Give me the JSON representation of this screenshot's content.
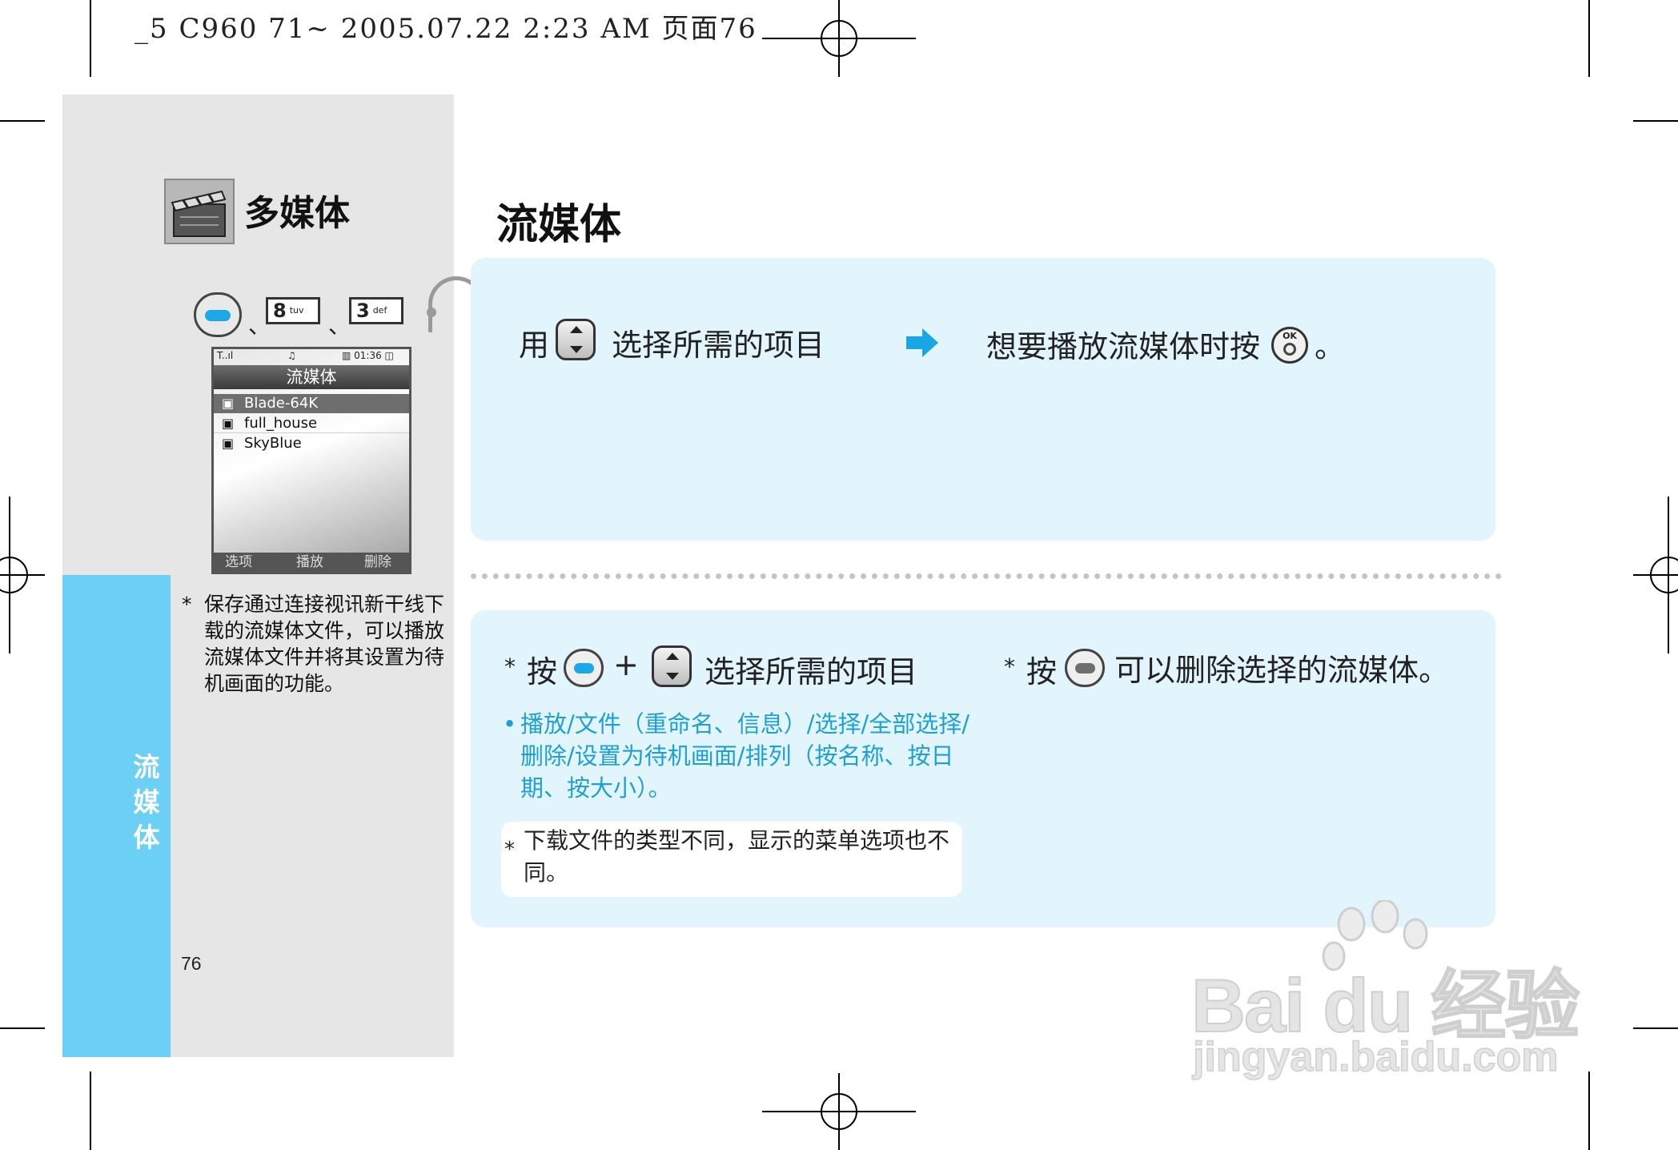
{
  "print_header": "_5  C960  71~  2005.07.22  2:23  AM  页面76",
  "sidebar": {
    "section_title": "多媒体",
    "vertical_label": "流 媒 体",
    "page_number": "76",
    "keys": {
      "sep1": "、",
      "sep2": "、",
      "key8_num": "8",
      "key8_sub": "tuv",
      "key3_num": "3",
      "key3_sub": "def"
    },
    "note_star": "*",
    "note": "保存通过连接视讯新干线下载的流媒体文件，可以播放流媒体文件并将其设置为待机画面的功能。"
  },
  "phone_screen": {
    "status_signal": "T..ıl",
    "status_mid": "♫",
    "status_time": "▥ 01:36 ◫",
    "title": "流媒体",
    "items": [
      "Blade-64K",
      "full_house",
      "SkyBlue"
    ],
    "selected_index": 0,
    "softkeys": [
      "选项",
      "播放",
      "删除"
    ]
  },
  "main": {
    "title": "流媒体",
    "step1_prefix": "用",
    "step1_text": "选择所需的项目",
    "step2_text": "想要播放流媒体时按",
    "step2_end": "。",
    "ok_label": "OK",
    "bottom_left_star": "*",
    "bottom_left_prefix": "按",
    "plus": "+",
    "bottom_left_text": "选择所需的项目",
    "bullet": "•",
    "menu_options": "播放/文件（重命名、信息）/选择/全部选择/删除/设置为待机画面/排列（按名称、按日期、按大小）。",
    "note_star": "*",
    "note": "下载文件的类型不同，显示的菜单选项也不同。",
    "bottom_right_star": "*",
    "bottom_right_prefix": "按",
    "bottom_right_text": "可以删除选择的流媒体。"
  },
  "watermark": {
    "brand_text": "Bai du 经验",
    "url": "jingyan.baidu.com"
  },
  "colors": {
    "accent_blue": "#6ccff5",
    "panel_blue": "#e3f5fc",
    "sidebar_grey": "#e6e6e6",
    "option_text_blue": "#1e9fd8",
    "arrow_blue": "#19a6e6"
  }
}
